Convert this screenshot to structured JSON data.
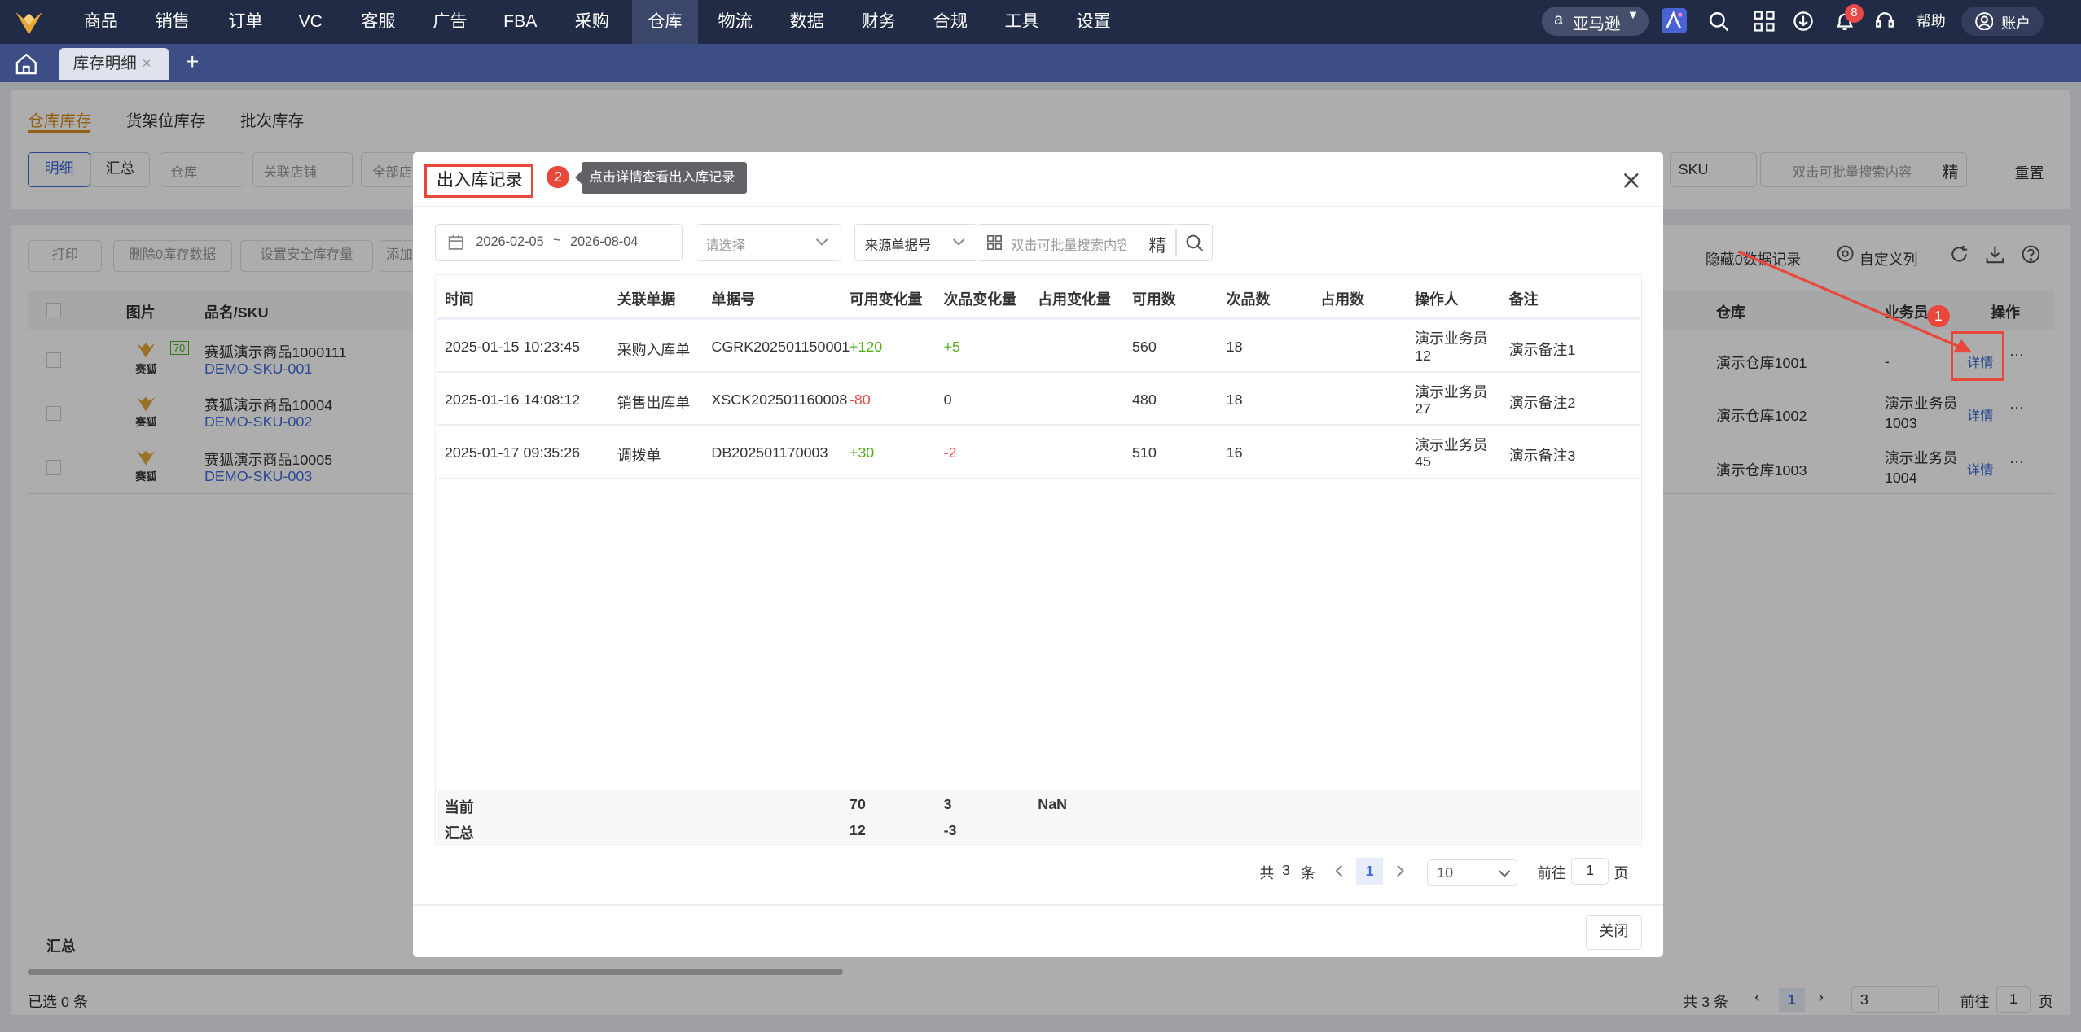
{
  "topnav": {
    "items": [
      "商品",
      "销售",
      "订单",
      "VC",
      "客服",
      "广告",
      "FBA",
      "采购",
      "仓库",
      "物流",
      "数据",
      "财务",
      "合规",
      "工具",
      "设置"
    ],
    "active": "仓库",
    "marketplace": "亚马逊",
    "notification_count": "8",
    "help": "帮助",
    "account": "账户"
  },
  "tabs": {
    "active_tab": "库存明细",
    "close": "×",
    "add": "+"
  },
  "page": {
    "subtabs": [
      "仓库库存",
      "货架位库存",
      "批次库存"
    ],
    "filter_buttons": [
      "明细",
      "汇总"
    ],
    "filter_selects": [
      "仓库",
      "关联店铺",
      "全部店"
    ],
    "sku_select": "SKU",
    "batch_search_placeholder": "双击可批量搜索内容",
    "precise": "精",
    "reset": "重置",
    "toolbar": [
      "打印",
      "删除0库存数据",
      "设置安全库存量",
      "添加"
    ],
    "hide_zero": "隐藏0数据记录",
    "custom_columns": "自定义列",
    "columns": [
      "图片",
      "品名/SKU",
      "仓库",
      "业务员",
      "操作"
    ],
    "rows": [
      {
        "name": "赛狐演示商品1000111",
        "sku": "DEMO-SKU-001",
        "warehouse": "演示仓库1001",
        "salesman": "-",
        "action": "详情",
        "tag": "70"
      },
      {
        "name": "赛狐演示商品10004",
        "sku": "DEMO-SKU-002",
        "warehouse": "演示仓库1002",
        "salesman": "演示业务员1003",
        "action": "详情"
      },
      {
        "name": "赛狐演示商品10005",
        "sku": "DEMO-SKU-003",
        "warehouse": "演示仓库1003",
        "salesman": "演示业务员1004",
        "action": "详情"
      }
    ],
    "logo_text": "赛狐",
    "summary_label": "汇总",
    "selected": "已选 0 条",
    "pagination": {
      "total": "共 3 条",
      "page": "1",
      "page_size": "3",
      "goto": "前往",
      "goto_value": "1",
      "unit": "页"
    },
    "more": "···"
  },
  "modal": {
    "title": "出入库记录",
    "step2": "2",
    "tooltip": "点击详情查看出入库记录",
    "step1": "1",
    "date_start": "2026-02-05",
    "date_sep": "~",
    "date_end": "2026-08-04",
    "select_placeholder": "请选择",
    "source_select": "来源单据号",
    "search_placeholder": "双击可批量搜索内容",
    "precise": "精",
    "columns": [
      "时间",
      "关联单据",
      "单据号",
      "可用变化量",
      "次品变化量",
      "占用变化量",
      "可用数",
      "次品数",
      "占用数",
      "操作人",
      "备注"
    ],
    "rows": [
      {
        "time": "2025-01-15 10:23:45",
        "type": "采购入库单",
        "doc": "CGRK202501150001",
        "avail_change": "+120",
        "defect_change": "+5",
        "occupy_change": "",
        "avail": "560",
        "defect": "18",
        "occupy": "",
        "operator_line1": "演示业务员",
        "operator_line2": "12",
        "remark": "演示备注1"
      },
      {
        "time": "2025-01-16 14:08:12",
        "type": "销售出库单",
        "doc": "XSCK202501160008",
        "avail_change": "-80",
        "defect_change": "0",
        "occupy_change": "",
        "avail": "480",
        "defect": "18",
        "occupy": "",
        "operator_line1": "演示业务员",
        "operator_line2": "27",
        "remark": "演示备注2"
      },
      {
        "time": "2025-01-17 09:35:26",
        "type": "调拨单",
        "doc": "DB202501170003",
        "avail_change": "+30",
        "defect_change": "-2",
        "occupy_change": "",
        "avail": "510",
        "defect": "16",
        "occupy": "",
        "operator_line1": "演示业务员",
        "operator_line2": "45",
        "remark": "演示备注3"
      }
    ],
    "summary": {
      "current_label": "当前",
      "current_avail": "70",
      "current_defect": "3",
      "current_occupy": "NaN",
      "total_label": "汇总",
      "total_avail": "12",
      "total_defect": "-3"
    },
    "pagination": {
      "prefix": "共",
      "total": "3",
      "suffix": "条",
      "page": "1",
      "page_size": "10",
      "goto": "前往",
      "goto_value": "1",
      "unit": "页"
    },
    "close_button": "关闭"
  }
}
